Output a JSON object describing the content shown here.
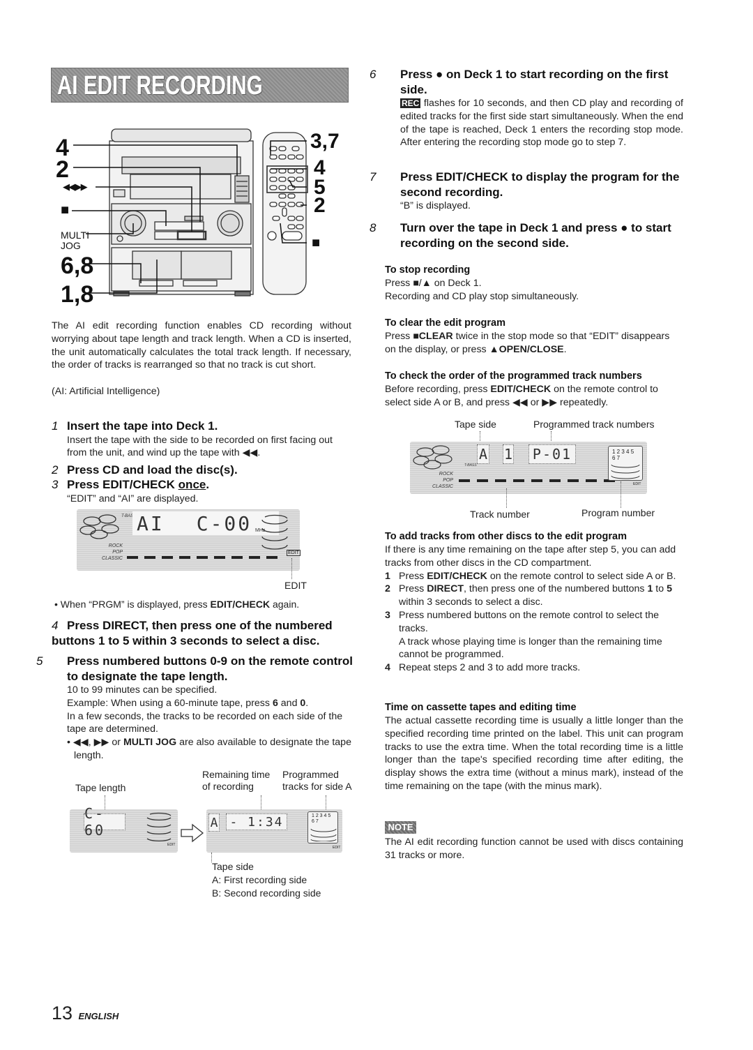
{
  "page": {
    "title": "AI EDIT RECORDING",
    "page_number": "13",
    "language": "ENGLISH"
  },
  "illustration": {
    "left_callouts": [
      "4",
      "2",
      "◀◀,▶▶",
      "■",
      "MULTI JOG",
      "6,8",
      "1,8"
    ],
    "right_callouts": [
      "3,7",
      "4",
      "5",
      "2",
      "■"
    ]
  },
  "intro": {
    "paragraph": "The AI edit recording function enables CD recording without worrying about tape length and track length.  When a CD is inserted, the unit automatically calculates the total track length. If necessary, the order of tracks is rearranged so that no track is cut short.",
    "note": "(AI: Artificial Intelligence)"
  },
  "steps": [
    {
      "num": "1",
      "heading": "Insert the tape into Deck 1.",
      "body": "Insert the tape with the side to be recorded on first facing out from the unit, and wind up the tape with ◀◀."
    },
    {
      "num": "2",
      "heading": "Press CD and load the disc(s).",
      "body": ""
    },
    {
      "num": "3",
      "heading_pre": "Press EDIT/CHECK ",
      "heading_underlined": "once",
      "heading_post": ".",
      "body": "“EDIT” and “AI” are displayed."
    },
    {
      "num": "4",
      "heading": "Press DIRECT, then press one of the numbered buttons 1 to 5 within 3 seconds to select a disc."
    },
    {
      "num": "5",
      "heading": "Press numbered buttons 0-9 on the remote control to designate the tape length.",
      "body_lines": [
        "10 to 99 minutes can be specified."
      ],
      "example_pre": "Example:  When using a 60-minute tape, press ",
      "example_b1": "6",
      "example_mid": " and ",
      "example_b2": "0",
      "example_post": ".",
      "body2": "In a few seconds, the tracks to be recorded on each side of the tape are determined.",
      "bullet_pre": "• ◀◀, ▶▶ or ",
      "bullet_bold": "MULTI JOG",
      "bullet_post": " are also available to designate the tape length."
    },
    {
      "num": "6",
      "heading": "Press ● on Deck 1 to start recording on the first side.",
      "badge": "REC",
      "body": " flashes for 10 seconds, and then CD play and recording of edited tracks for the first side start simultaneously. When the end of the tape is reached, Deck 1 enters the recording stop mode.  After entering the recording stop mode go to step 7."
    },
    {
      "num": "7",
      "heading": "Press EDIT/CHECK to display the program for the second recording.",
      "body": "“B” is displayed."
    },
    {
      "num": "8",
      "heading": "Turn over the tape in Deck 1 and press ● to start recording on the second side."
    }
  ],
  "display1": {
    "text_left": "AI",
    "text_right": "C-00",
    "tbass": "T-BASS",
    "genres": [
      "ROCK",
      "POP",
      "CLASSIC"
    ],
    "unit": "MHz",
    "edit_indicator": "EDIT",
    "label": "EDIT",
    "tip_pre": "• When “PRGM” is displayed, press ",
    "tip_bold": "EDIT/CHECK",
    "tip_post": " again."
  },
  "display2": {
    "labels": {
      "tape_length": "Tape length",
      "remaining_time": "Remaining time of recording",
      "programmed_tracks": "Programmed tracks for side A",
      "tape_side": "Tape side",
      "side_a": "A: First recording side",
      "side_b": "B: Second recording side"
    },
    "before_text": "C-60",
    "after_side": "A",
    "after_time": "- 1:34",
    "tracks_row1": "1 2 3 4 5",
    "tracks_row2": "6 7",
    "edit_indicator": "EDIT"
  },
  "to_stop": {
    "heading": "To stop recording",
    "line1": "Press ■/▲ on Deck 1.",
    "line2": "Recording and CD play stop simultaneously."
  },
  "to_clear": {
    "heading": "To clear the edit program",
    "pre": "Press ",
    "bold1": "■CLEAR",
    "mid": " twice in the stop mode so that “EDIT” disappears on the display, or press ",
    "bold2": "▲OPEN/CLOSE",
    "post": "."
  },
  "to_check": {
    "heading": "To check the order of the programmed track numbers",
    "pre": "Before recording, press ",
    "bold": "EDIT/CHECK",
    "post": " on the remote control to select side A or B, and press ◀◀ or ▶▶ repeatedly.",
    "labels": {
      "tape_side": "Tape side",
      "programmed_track_numbers": "Programmed track numbers",
      "track_number": "Track number",
      "program_number": "Program number"
    },
    "display": {
      "side": "A",
      "track": "1",
      "program": "P-01",
      "tracks_row1": "1 2 3 4 5",
      "tracks_row2": "6 7",
      "edit_indicator": "EDIT",
      "tbass": "T-BASS",
      "genres": [
        "ROCK",
        "POP",
        "CLASSIC"
      ]
    }
  },
  "to_add": {
    "heading": "To add tracks from other discs to the edit program",
    "intro": "If there is any time remaining on the tape after step 5, you can add tracks from other discs in the CD compartment.",
    "items": [
      {
        "n": "1",
        "pre": "Press ",
        "bold": "EDIT/CHECK",
        "post": " on the remote control to select side A or B."
      },
      {
        "n": "2",
        "pre": "Press ",
        "bold": "DIRECT",
        "post": ", then press one of the numbered buttons ",
        "bold2": "1",
        "post2": " to ",
        "bold3": "5",
        "post3": " within 3 seconds to select a disc."
      },
      {
        "n": "3",
        "pre": "Press numbered buttons on the remote control to select the tracks.",
        "extra": "A track whose playing time is longer than the remaining time cannot be programmed."
      },
      {
        "n": "4",
        "pre": "Repeat steps 2 and 3 to add more tracks."
      }
    ]
  },
  "time_on_tapes": {
    "heading": "Time on cassette tapes and editing time",
    "body": "The actual cassette recording time is usually a little longer than the specified recording time printed on the label.  This unit can program tracks to use the extra time.  When the total recording time is a little longer than the tape's specified recording time after editing, the display shows the extra time (without a minus mark), instead of the time remaining on the tape (with the minus mark)."
  },
  "note": {
    "badge": "NOTE",
    "body": "The AI edit recording function cannot be used with discs containing 31 tracks or more."
  }
}
